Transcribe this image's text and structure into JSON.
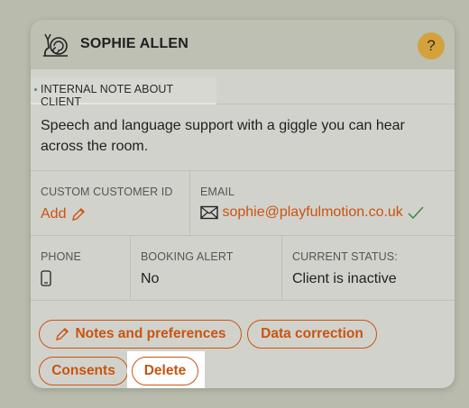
{
  "client": {
    "name": "SOPHIE ALLEN",
    "help_label": "?"
  },
  "tab": {
    "label": "INTERNAL NOTE ABOUT CLIENT"
  },
  "note": {
    "text": "Speech and language support with a giggle you can hear across the room."
  },
  "fields": {
    "custom_id": {
      "label": "CUSTOM CUSTOMER ID",
      "action": "Add"
    },
    "email": {
      "label": "EMAIL",
      "value": "sophie@playfulmotion.co.uk",
      "verified": true
    },
    "phone": {
      "label": "PHONE"
    },
    "booking_alert": {
      "label": "BOOKING ALERT",
      "value": "No"
    },
    "status": {
      "label": "CURRENT STATUS:",
      "value": "Client is inactive"
    }
  },
  "buttons": {
    "notes": "Notes and preferences",
    "data_correction": "Data correction",
    "consents": "Consents",
    "delete": "Delete"
  },
  "colors": {
    "accent": "#c95410",
    "help": "#d4a23c",
    "verified": "#3f8a4a"
  },
  "icons": [
    "snail-icon",
    "help-icon",
    "pencil-icon",
    "envelope-icon",
    "check-icon",
    "phone-icon"
  ]
}
